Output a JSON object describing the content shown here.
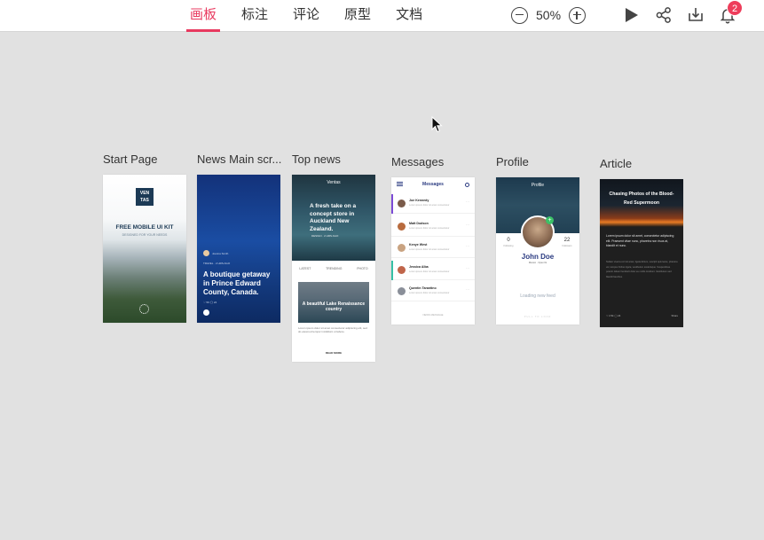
{
  "header": {
    "tabs": [
      {
        "label": "画板",
        "active": true
      },
      {
        "label": "标注",
        "active": false
      },
      {
        "label": "评论",
        "active": false
      },
      {
        "label": "原型",
        "active": false
      },
      {
        "label": "文档",
        "active": false
      }
    ],
    "zoom": "50%",
    "notification_count": "2",
    "accent_color": "#e8395f"
  },
  "artboards": {
    "start": {
      "label": "Start Page",
      "logo_line1": "VEN",
      "logo_line2": "TAS",
      "title": "FREE MOBILE UI KIT",
      "subtitle": "DESIGNED FOR YOUR NEEDS"
    },
    "news": {
      "label": "News Main scr...",
      "author": "Joanna Smith",
      "meta": "TRAVEL · 2 HRS AGO",
      "title": "A boutique getaway in Prince Edward County, Canada.",
      "stats": "♡ 56  ◯ 24"
    },
    "topnews": {
      "label": "Top news",
      "brand": "Ventas",
      "hero_title": "A fresh take on a concept store in Auckland New Zealand.",
      "hero_meta": "DESIGN · 2 HRS AGO",
      "categories": [
        "LATEST",
        "TRENDING",
        "PHOTO"
      ],
      "card_title": "A beautiful Lake Renaissance country",
      "text": "Lorem ipsum dolor sit amet consectetur adipiscing elit, sed do eiusmod tempor incididunt ut labore.",
      "read_more": "READ MORE"
    },
    "messages": {
      "label": "Messages",
      "title": "Messages",
      "rows": [
        {
          "name": "Joe Kennedy",
          "text": "Lorem ipsum dolor sit amet consectetur",
          "color": "#7a5b4a",
          "accent": "#7c4bd6"
        },
        {
          "name": "Matt Dodson",
          "text": "Lorem ipsum dolor sit amet consectetur",
          "color": "#b86b3e",
          "accent": ""
        },
        {
          "name": "Kenye West",
          "text": "Lorem ipsum dolor sit amet consectetur",
          "color": "#c9a381",
          "accent": ""
        },
        {
          "name": "Jessica Alba",
          "text": "Lorem ipsum dolor sit amet consectetur",
          "color": "#c0654a",
          "accent": "#35c0a6"
        },
        {
          "name": "Quentin Tarantino",
          "text": "Lorem ipsum dolor sit amet consectetur",
          "color": "#8a8f99",
          "accent": ""
        }
      ],
      "footer": "NEWS MESSAGE"
    },
    "profile": {
      "label": "Profile",
      "title": "Profile",
      "stat_left": "0",
      "stat_left_label": "Following",
      "stat_right": "22",
      "stat_right_label": "Followers",
      "name": "John Doe",
      "sub": "Mexico · Open Ilk",
      "loading": "Loading new feed",
      "footer": "PULL TO LOAD"
    },
    "article": {
      "label": "Article",
      "title": "Chasing Photos of the Blood-Red Supermoon",
      "lead": "Lorem ipsum dolor sit amet, consectetur adipiscing elit. Praesent vitae nunc, pharetra non risus at, blandit et nunc.",
      "body": "Nullam viverra orci sit amet, ligula dictum, suscipit quis lacus, pharetra vel, tempus finibus ligula, vestibulum scelerisque. Suspendisse potenti. Etiam hendrerit dolor eu mollis tincidunt. Vestibulum sed blandit faucibus.",
      "likes": "♡ 2.5k  ◯ 24",
      "share": "Share"
    }
  }
}
